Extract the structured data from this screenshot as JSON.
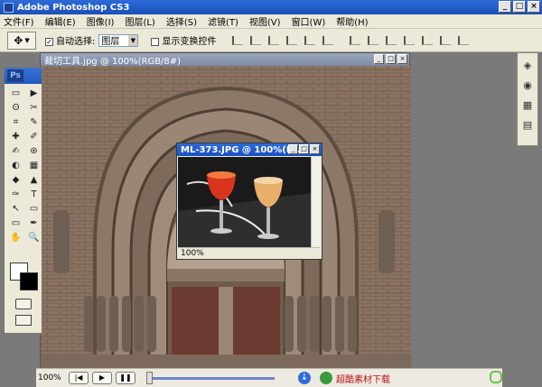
{
  "app": {
    "title": "Adobe Photoshop CS3"
  },
  "window_controls": {
    "minimize": "_",
    "maximize": "□",
    "close": "×"
  },
  "menu": {
    "items": [
      "文件(F)",
      "编辑(E)",
      "图像(I)",
      "图层(L)",
      "选择(S)",
      "滤镜(T)",
      "视图(V)",
      "窗口(W)",
      "帮助(H)"
    ]
  },
  "options": {
    "auto_select_label": "自动选择:",
    "auto_select_checked": true,
    "auto_select_value": "图层",
    "show_transform_label": "显示变换控件",
    "show_transform_checked": false
  },
  "toolbox": {
    "logo": "Ps",
    "tools": [
      "▭",
      "▶",
      "ʘ",
      "✂",
      "⌗",
      "✎",
      "✚",
      "✐",
      "✍",
      "⊛",
      "◐",
      "▦",
      "◆",
      "▲",
      "✑",
      "T",
      "↖",
      "▭",
      "▭",
      "✒",
      "✋",
      "🔍"
    ]
  },
  "document": {
    "title": "裁切工具.jpg @ 100%(RGB/8#)"
  },
  "sub_document": {
    "title": "ML-373.JPG @ 100%(R...",
    "zoom": "100%"
  },
  "right_panel": {
    "icons": [
      "layers-icon",
      "navigator-icon",
      "swatches-icon",
      "history-icon"
    ]
  },
  "player": {
    "zoom": "100%",
    "brand_text": "超酷素材下载"
  },
  "colors": {
    "titlebar": "#2d6bd8",
    "chrome": "#ece9d8",
    "brand_red": "#c0121b"
  }
}
